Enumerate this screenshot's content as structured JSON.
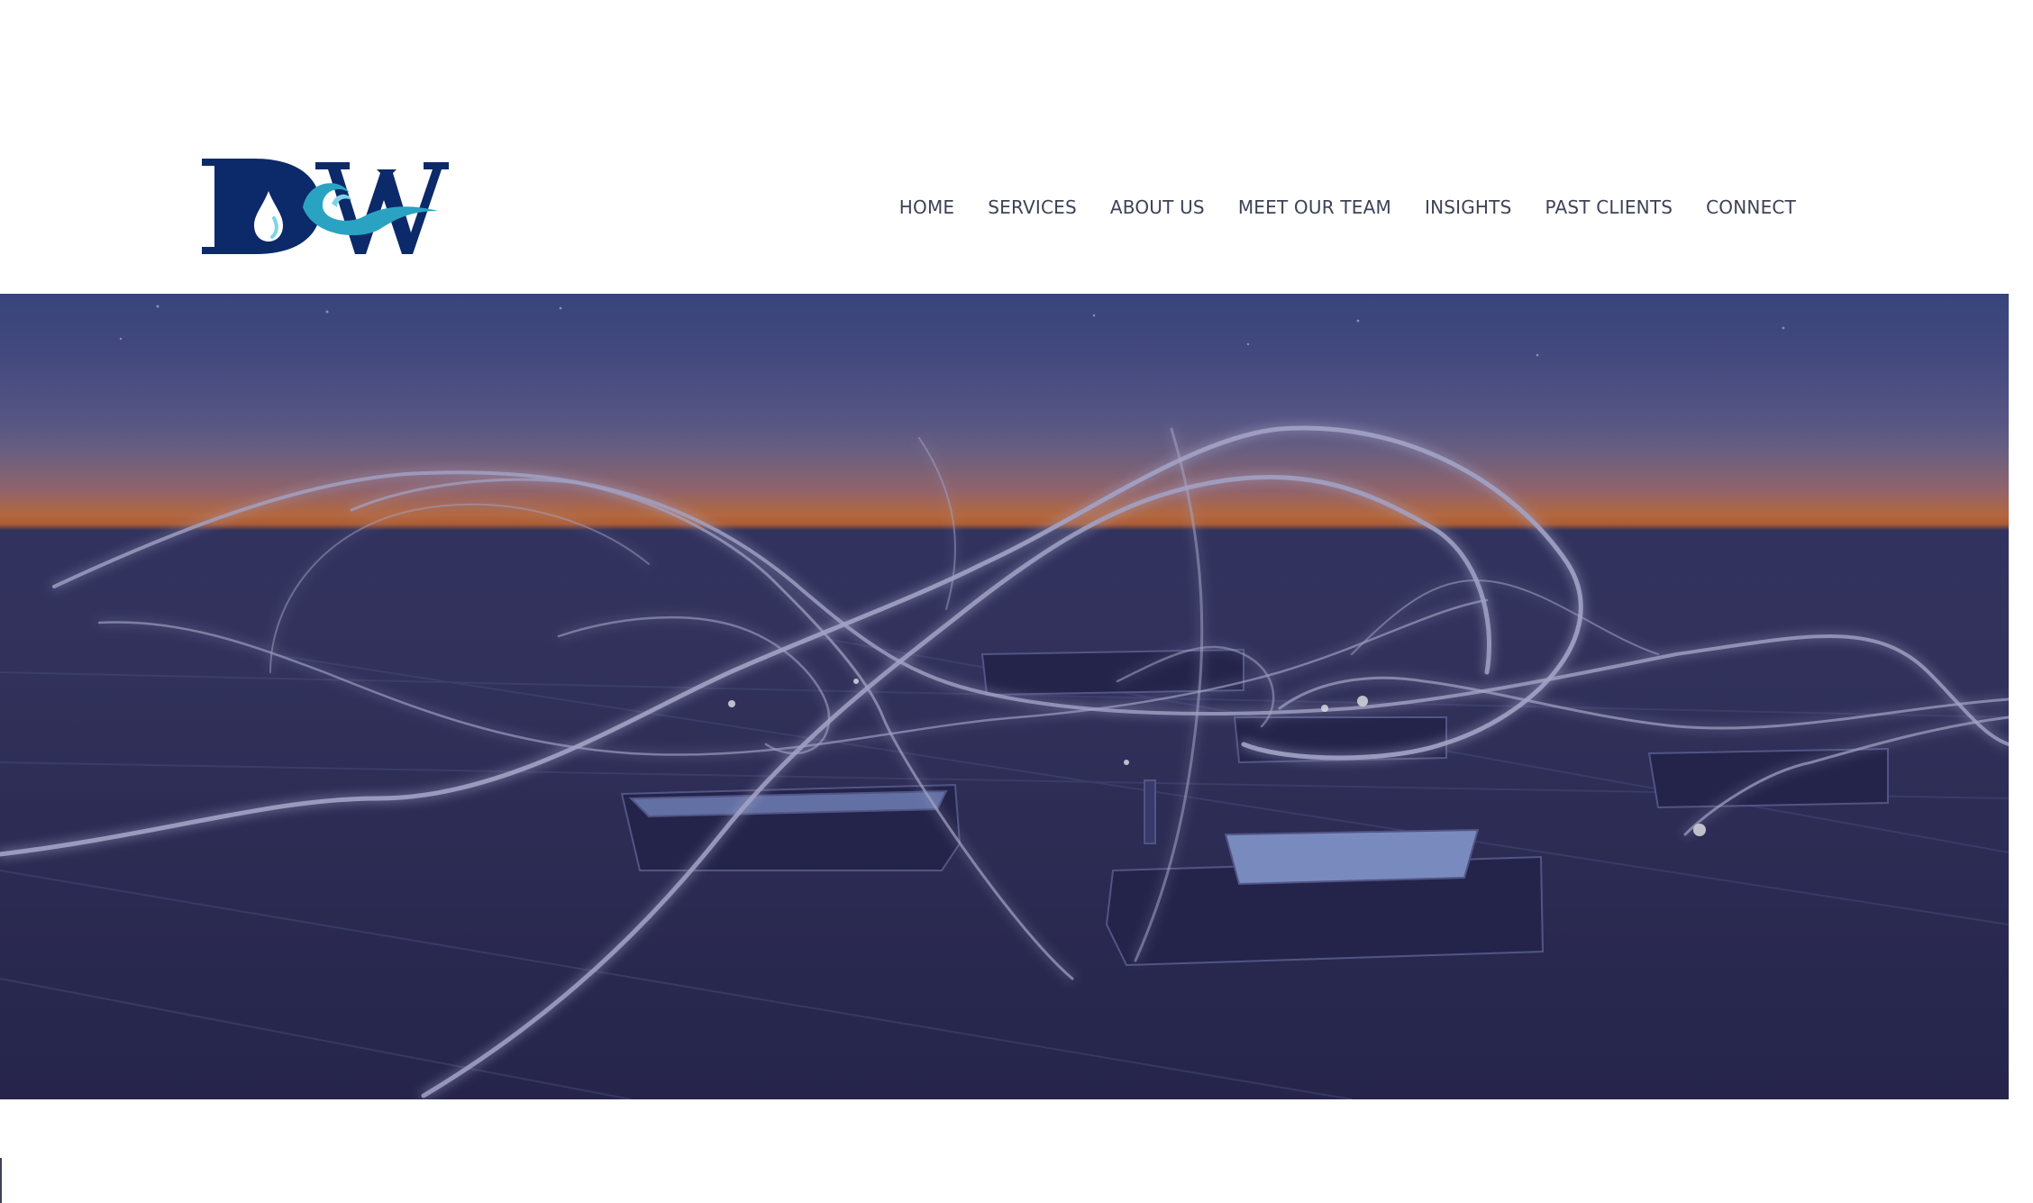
{
  "brand": {
    "logo_text": "DW",
    "logo_colors": {
      "navy": "#0c2a6a",
      "teal": "#2aa3c3",
      "light": "#7fd3e6"
    }
  },
  "nav": {
    "items": [
      {
        "label": "HOME"
      },
      {
        "label": "SERVICES"
      },
      {
        "label": "ABOUT US"
      },
      {
        "label": "MEET OUR TEAM"
      },
      {
        "label": "INSIGHTS"
      },
      {
        "label": "PAST CLIENTS"
      },
      {
        "label": "CONNECT"
      }
    ]
  },
  "hero": {
    "image": "rooftop-light-painting-at-dusk"
  },
  "colors": {
    "nav_text": "#3d4256",
    "hero_overlay": "#2c2a55"
  }
}
